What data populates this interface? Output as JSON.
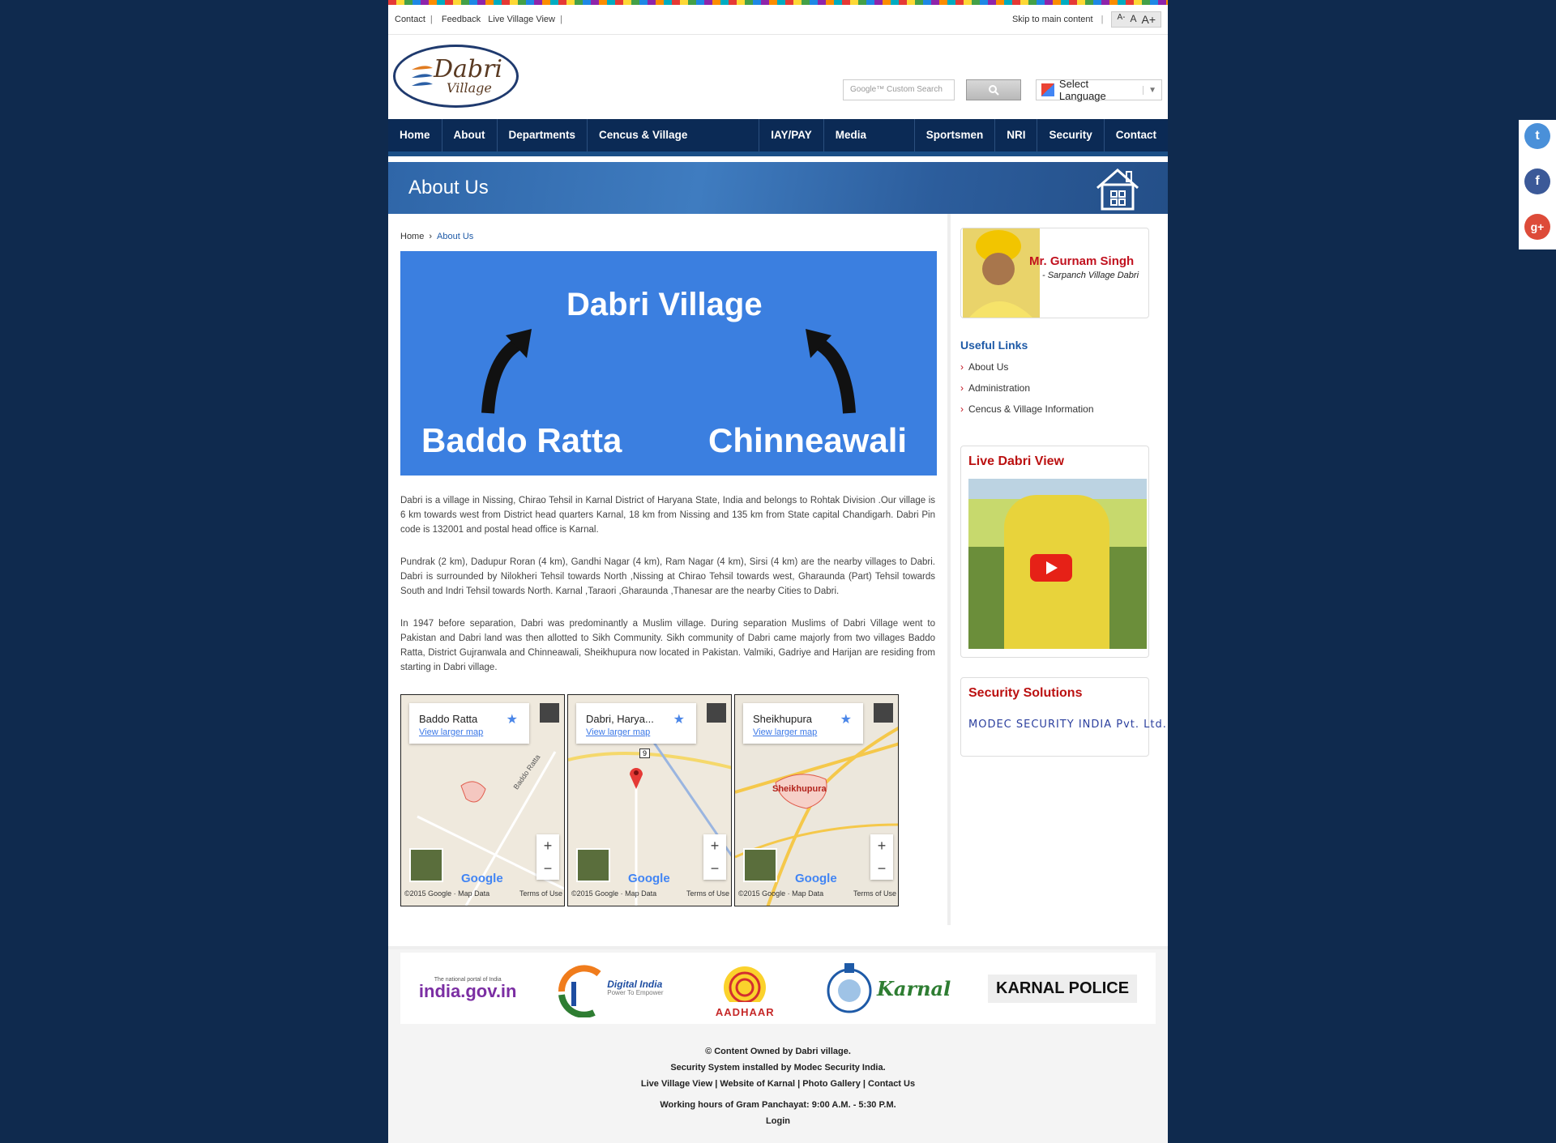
{
  "topbar": {
    "links": [
      "Contact",
      "Feedback",
      "Live Village View"
    ],
    "skip": "Skip to main content",
    "font_sizes": [
      "A-",
      "A",
      "A+"
    ]
  },
  "logo": {
    "line1": "Dabri",
    "line2": "Village"
  },
  "search": {
    "placeholder": "Google™ Custom Search"
  },
  "language": {
    "label": "Select Language"
  },
  "nav": [
    "Home",
    "About",
    "Departments",
    "Cencus & Village Information",
    "IAY/PAY",
    "Media Center",
    "Sportsmen",
    "NRI",
    "Security",
    "Contact"
  ],
  "banner": {
    "title": "About Us"
  },
  "breadcrumb": {
    "home": "Home",
    "separator": "›",
    "current": "About Us"
  },
  "sign": {
    "top": "Dabri Village",
    "left": "Baddo Ratta",
    "right": "Chinneawali"
  },
  "paragraphs": [
    "Dabri is a village in Nissing, Chirao Tehsil in Karnal District of Haryana State, India and belongs to Rohtak Division .Our village is 6 km towards west from District head quarters Karnal, 18 km from Nissing and 135 km from State capital Chandigarh. Dabri Pin code is 132001 and postal head office is Karnal.",
    "Pundrak (2 km), Dadupur Roran (4 km), Gandhi Nagar (4 km), Ram Nagar (4 km), Sirsi (4 km) are the nearby villages to Dabri. Dabri is surrounded by Nilokheri Tehsil towards North ,Nissing at Chirao Tehsil towards west, Gharaunda (Part) Tehsil towards South and Indri Tehsil towards North. Karnal ,Taraori ,Gharaunda ,Thanesar are the nearby Cities to Dabri.",
    "In 1947 before separation, Dabri was predominantly a Muslim village. During separation Muslims of Dabri Village went to Pakistan and Dabri land was then allotted to Sikh Community. Sikh community of Dabri came majorly from two villages Baddo Ratta, District Gujranwala and Chinneawali, Sheikhupura now located in Pakistan. Valmiki, Gadriye and Harijan are residing from starting in Dabri village."
  ],
  "maps": [
    {
      "name": "Baddo Ratta",
      "link": "View larger map",
      "label": "Baddo Ratta",
      "copy": "©2015 Google · Map Data",
      "terms": "Terms of Use"
    },
    {
      "name": "Dabri, Harya...",
      "link": "View larger map",
      "label": "9",
      "copy": "©2015 Google · Map Data",
      "terms": "Terms of Use"
    },
    {
      "name": "Sheikhupura",
      "link": "View larger map",
      "label": "Sheikhupura",
      "copy": "©2015 Google · Map Data",
      "terms": "Terms of Use"
    }
  ],
  "sidebar": {
    "sarpanch_name": "Mr. Gurnam Singh",
    "sarpanch_title": "- Sarpanch Village Dabri",
    "useful_links_title": "Useful Links",
    "useful_links": [
      "About Us",
      "Administration",
      "Cencus & Village Information"
    ],
    "live_title": "Live Dabri View",
    "security_title": "Security Solutions",
    "security_company": "MODEC SECURITY INDIA Pvt. Ltd."
  },
  "partners": [
    "india.gov.in",
    "Digital India",
    "AADHAAR",
    "Karnal",
    "KARNAL POLICE"
  ],
  "partner_tagline": "The national portal of India",
  "digital_tagline": "Power To Empower",
  "footer": {
    "line1": "© Content Owned by Dabri village.",
    "line2": "Security System installed by Modec Security India.",
    "links": [
      "Live Village View",
      "Website of Karnal",
      "Photo Gallery",
      "Contact Us"
    ],
    "hours": "Working hours of Gram Panchayat: 9:00 A.M. - 5:30 P.M.",
    "login": "Login"
  },
  "social": [
    "twitter-icon",
    "facebook-icon",
    "google-plus-icon"
  ]
}
